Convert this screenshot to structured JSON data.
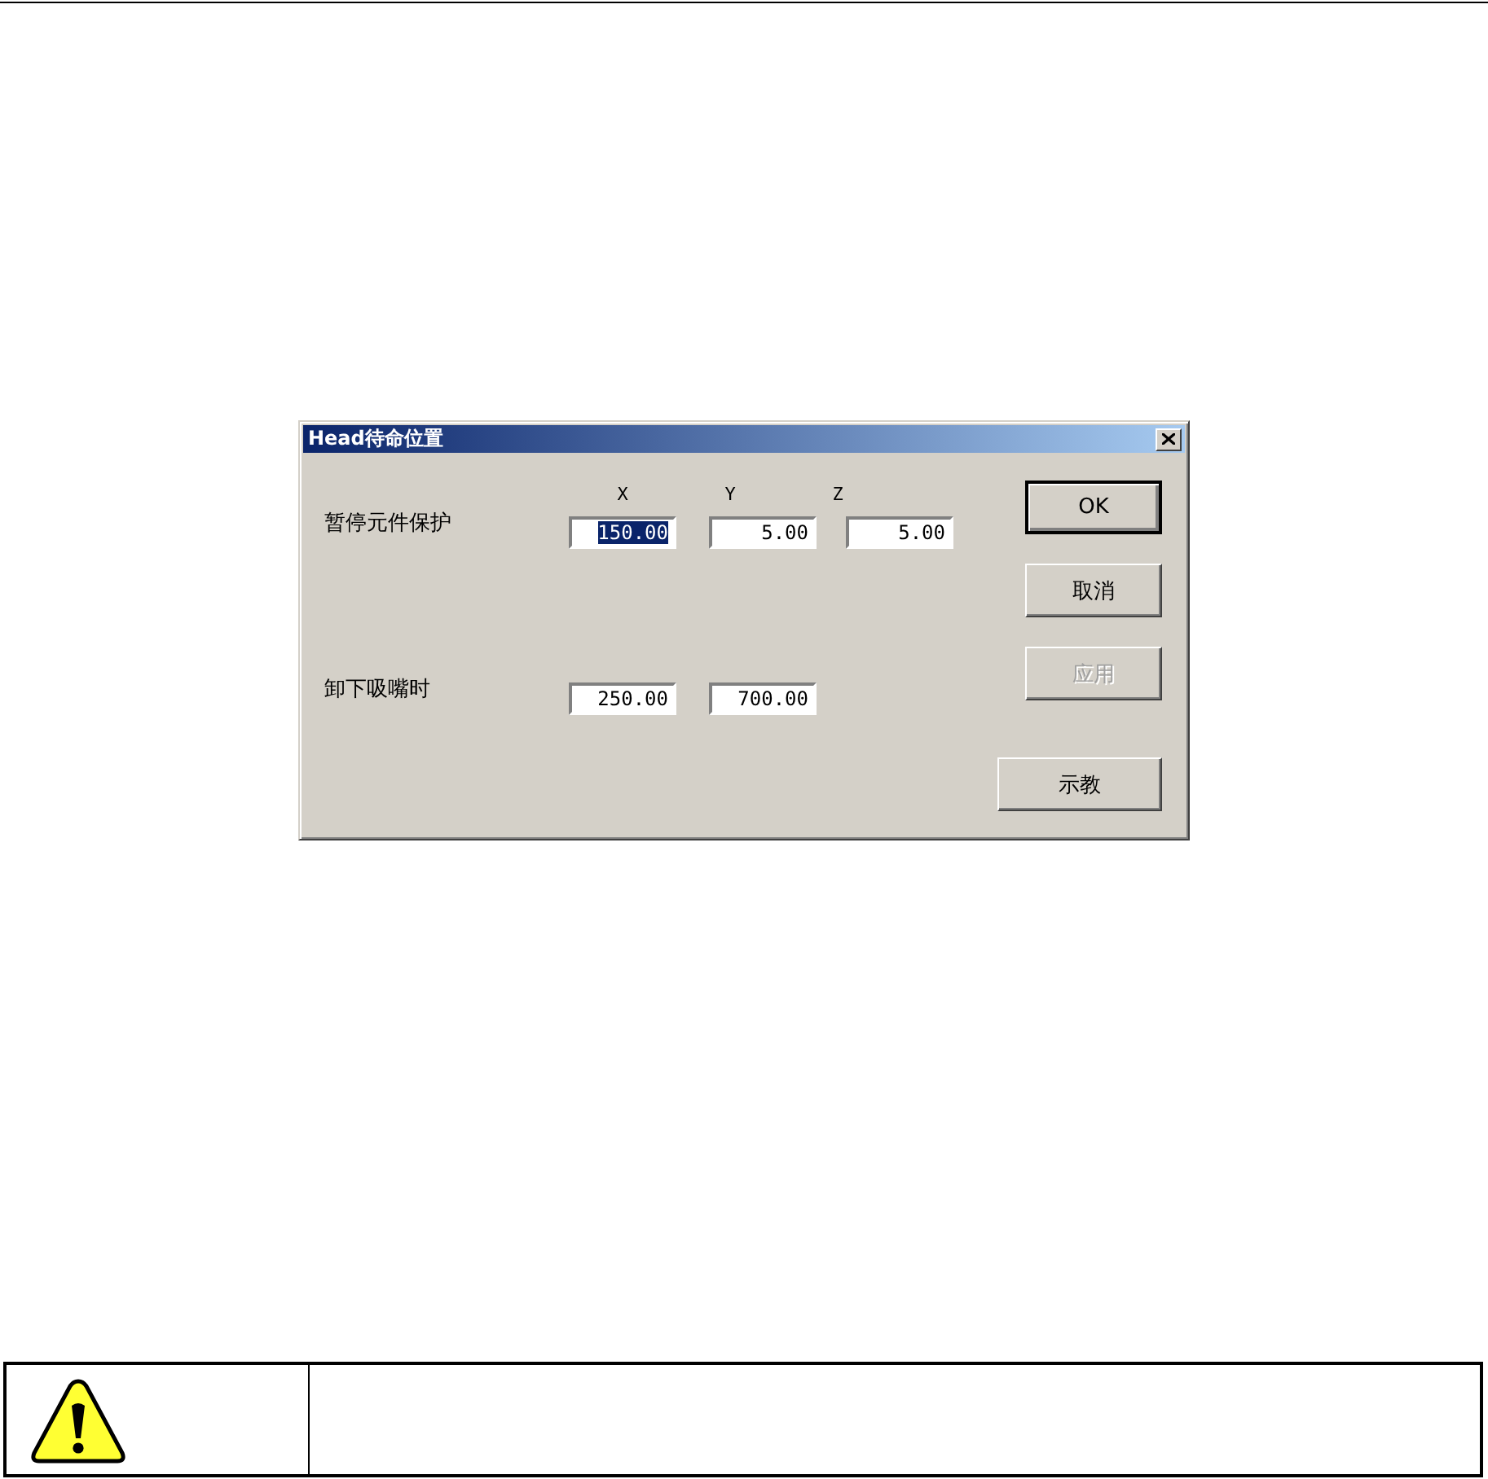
{
  "dialog": {
    "title": "Head待命位置",
    "columns": [
      "X",
      "Y",
      "Z"
    ],
    "rows": [
      {
        "label": "暂停元件保护",
        "fields": [
          {
            "value": "150.00",
            "selected": true
          },
          {
            "value": "5.00",
            "selected": false
          },
          {
            "value": "5.00",
            "selected": false
          }
        ]
      },
      {
        "label": "卸下吸嘴时",
        "fields": [
          {
            "value": "250.00",
            "selected": false
          },
          {
            "value": "700.00",
            "selected": false
          }
        ]
      }
    ],
    "buttons": [
      {
        "label": "OK",
        "default": true,
        "disabled": false
      },
      {
        "label": "取消",
        "default": false,
        "disabled": false
      },
      {
        "label": "应用",
        "default": false,
        "disabled": true
      },
      {
        "label": "示教",
        "default": false,
        "disabled": false
      }
    ]
  }
}
